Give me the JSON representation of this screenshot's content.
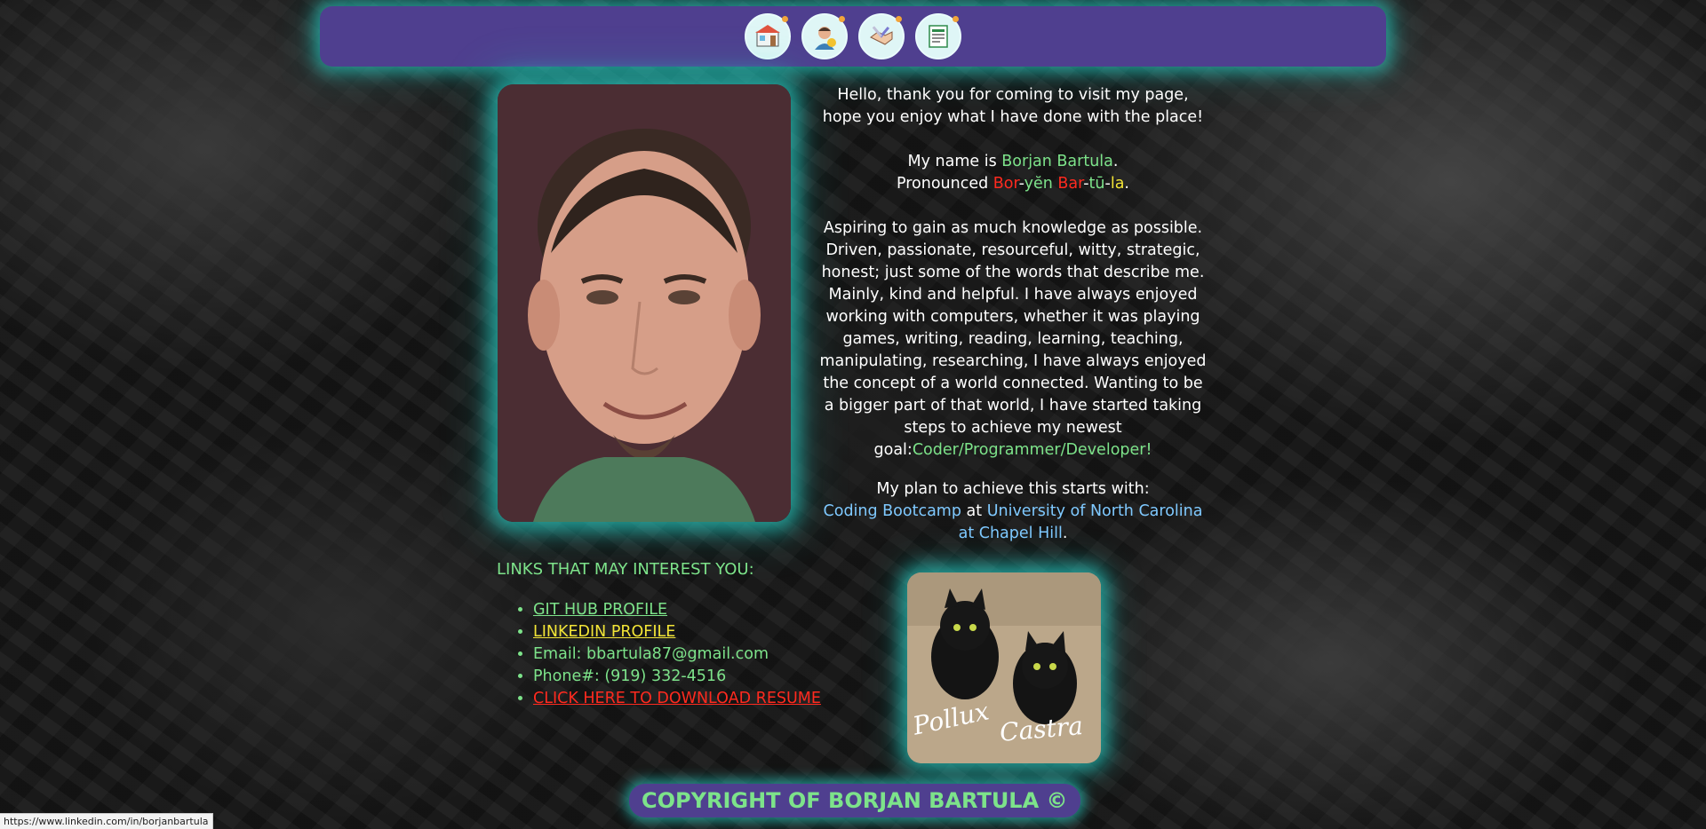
{
  "nav": {
    "icons": [
      {
        "name": "home-store-icon"
      },
      {
        "name": "about-person-icon"
      },
      {
        "name": "tools-handshake-icon"
      },
      {
        "name": "portfolio-document-icon"
      }
    ]
  },
  "bio": {
    "intro": "Hello, thank you for coming to visit my page, hope you enjoy what I have done with the place!",
    "name_prefix": "My name is ",
    "name": "Borjan Bartula",
    "name_suffix": ".",
    "pron_prefix": "Pronounced ",
    "pron_parts": [
      "Bor",
      "-",
      "yĕn",
      " ",
      "Bar",
      "-",
      "tū",
      "-",
      "la"
    ],
    "pron_suffix": ".",
    "about": "Aspiring to gain as much knowledge as possible. Driven, passionate, resourceful, witty, strategic, honest; just some of the words that describe me. Mainly, kind and helpful. I have always enjoyed working with computers, whether it was playing games, writing, reading, learning, teaching, manipulating, researching, I have always enjoyed the concept of a world connected. Wanting to be a bigger part of that world, I have started taking steps to achieve my newest goal:",
    "goal": "Coder/Programmer/Developer!",
    "plan_intro": "My plan to achieve this starts with:",
    "bootcamp": "Coding Bootcamp",
    "at": " at ",
    "university": "University of North Carolina at Chapel Hill",
    "period": "."
  },
  "links": {
    "heading": "LINKS THAT MAY INTEREST YOU:",
    "github": "GIT HUB PROFILE",
    "linkedin": "LINKEDIN PROFILE",
    "email": "Email: bbartula87@gmail.com",
    "phone": "Phone#: (919) 332-4516",
    "resume": "CLICK HERE TO DOWNLOAD RESUME"
  },
  "cats": {
    "left_name": "Pollux",
    "right_name": "Castra"
  },
  "footer": {
    "copyright": "COPYRIGHT OF BORJAN BARTULA ©"
  },
  "status": {
    "url": "https://www.linkedin.com/in/borjanbartula"
  },
  "colors": {
    "accent_purple": "#4f3f8f",
    "glow_teal": "#28dcd2",
    "green": "#7de38a",
    "red": "#ff2a1f",
    "yellow": "#f3e537",
    "blue": "#7fc9ff"
  }
}
